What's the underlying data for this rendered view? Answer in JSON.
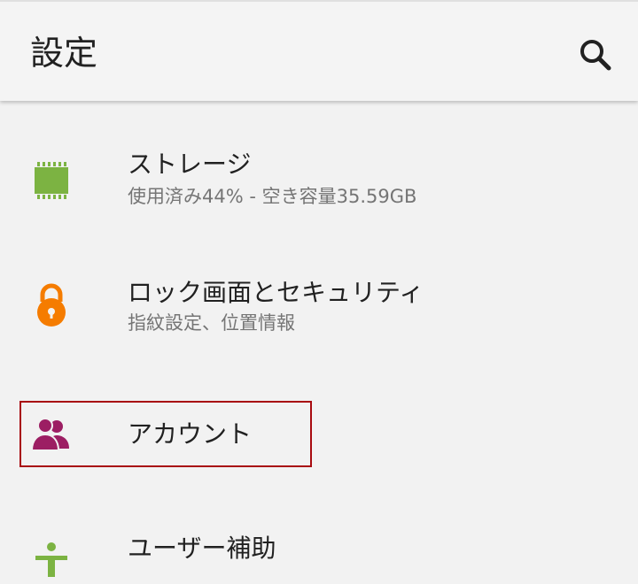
{
  "appbar": {
    "title": "設定",
    "search_icon": "search-icon"
  },
  "items": [
    {
      "title": "ストレージ",
      "subtitle": "使用済み44% - 空き容量35.59GB",
      "icon": "storage-chip-icon",
      "color": "#7cb342"
    },
    {
      "title": "ロック画面とセキュリティ",
      "subtitle": "指紋設定、位置情報",
      "icon": "lock-icon",
      "color": "#f57c00"
    },
    {
      "title": "アカウント",
      "subtitle": "",
      "icon": "accounts-icon",
      "color": "#9c1e63",
      "highlighted": true
    },
    {
      "title": "ユーザー補助",
      "subtitle": "",
      "icon": "accessibility-icon",
      "color": "#7cb342"
    }
  ],
  "colors": {
    "highlight_border": "#a80b10",
    "background": "#f2f2f2"
  }
}
